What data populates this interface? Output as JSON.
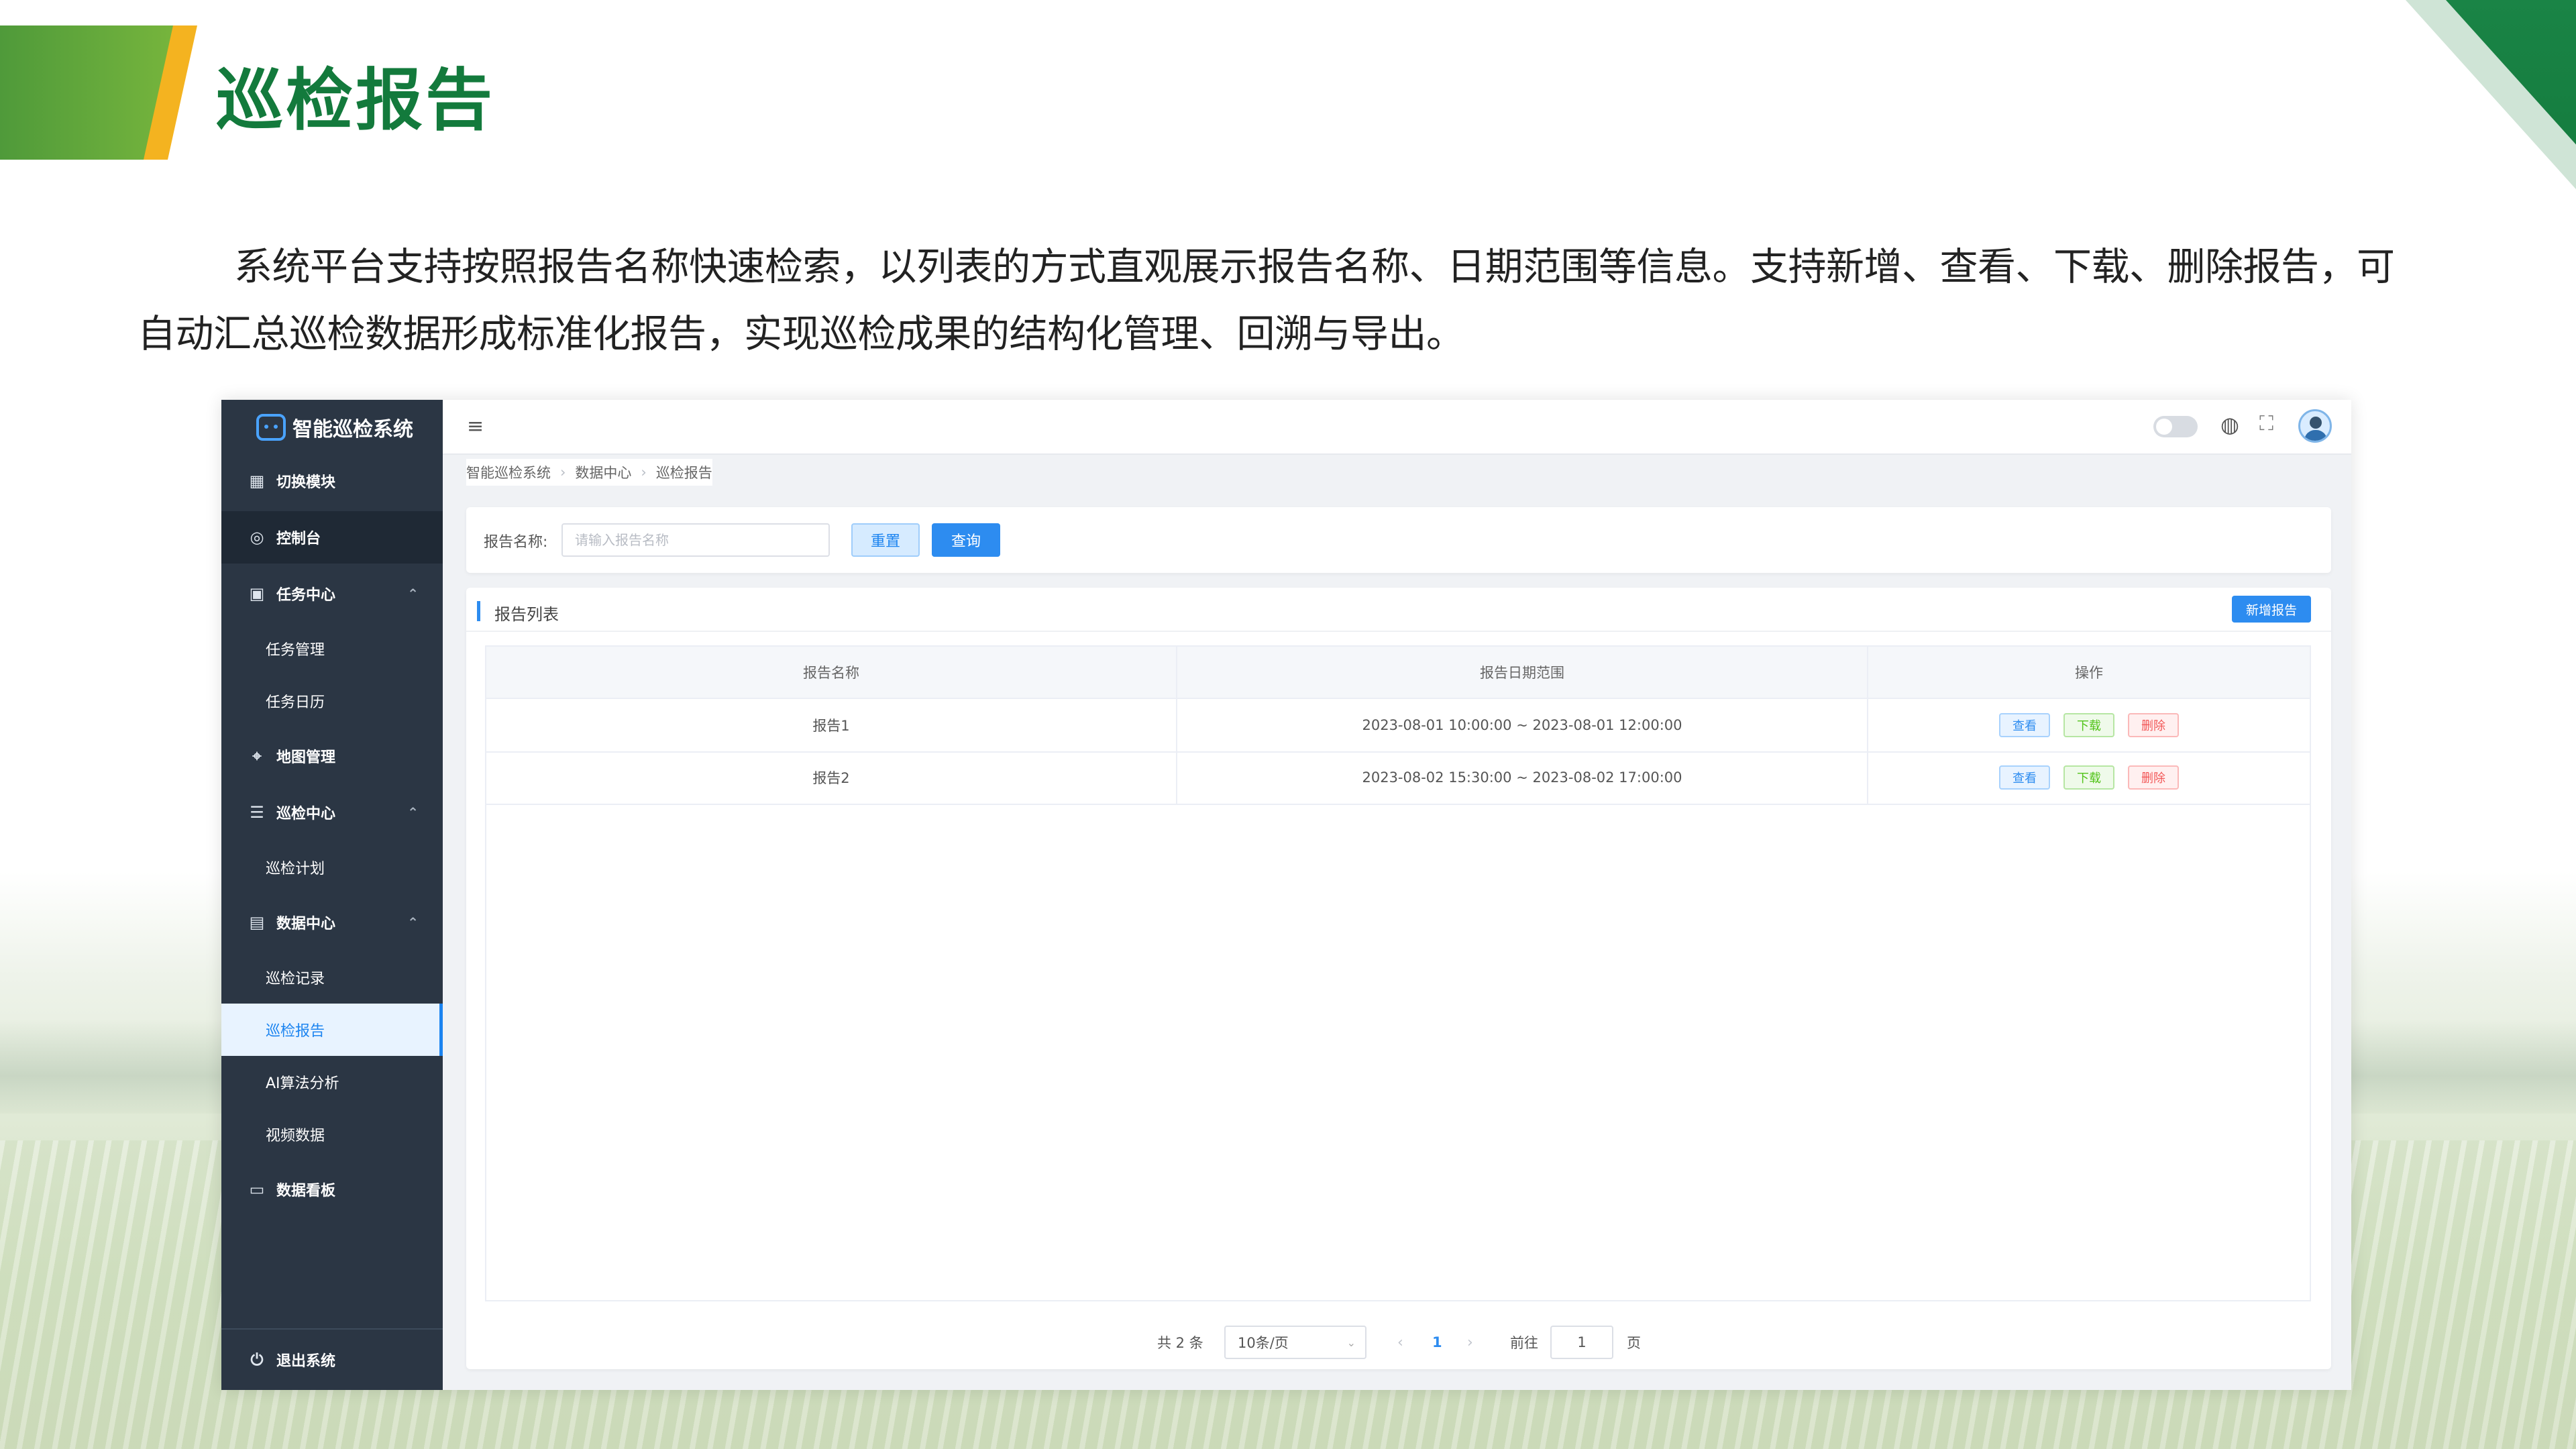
{
  "slide": {
    "title": "巡检报告",
    "intro": "系统平台支持按照报告名称快速检索，以列表的方式直观展示报告名称、日期范围等信息。支持新增、查看、下载、删除报告，可自动汇总巡检数据形成标准化报告，实现巡检成果的结构化管理、回溯与导出。"
  },
  "app": {
    "name": "智能巡检系统",
    "sidebar": {
      "items": [
        {
          "label": "切换模块",
          "icon": "grid-icon"
        },
        {
          "label": "控制台",
          "icon": "target-icon"
        },
        {
          "label": "任务中心",
          "icon": "calendar-icon",
          "expanded": true
        },
        {
          "label": "任务管理"
        },
        {
          "label": "任务日历"
        },
        {
          "label": "地图管理",
          "icon": "map-pin-icon"
        },
        {
          "label": "巡检中心",
          "icon": "clipboard-icon",
          "expanded": true
        },
        {
          "label": "巡检计划"
        },
        {
          "label": "数据中心",
          "icon": "chart-icon",
          "expanded": true
        },
        {
          "label": "巡检记录"
        },
        {
          "label": "巡检报告",
          "selected": true
        },
        {
          "label": "AI算法分析"
        },
        {
          "label": "视频数据"
        },
        {
          "label": "数据看板",
          "icon": "dashboard-icon"
        }
      ],
      "logout": "退出系统"
    },
    "breadcrumb": [
      "智能巡检系统",
      "数据中心",
      "巡检报告"
    ],
    "search": {
      "label": "报告名称:",
      "placeholder": "请输入报告名称",
      "value": "",
      "reset": "重置",
      "query": "查询"
    },
    "list": {
      "title": "报告列表",
      "add_button": "新增报告",
      "columns": [
        "报告名称",
        "报告日期范围",
        "操作"
      ],
      "rows": [
        {
          "name": "报告1",
          "range": "2023-08-01 10:00:00 ~ 2023-08-01 12:00:00"
        },
        {
          "name": "报告2",
          "range": "2023-08-02 15:30:00 ~ 2023-08-02 17:00:00"
        }
      ],
      "actions": {
        "view": "查看",
        "download": "下载",
        "delete": "删除"
      }
    },
    "pagination": {
      "total": "共 2 条",
      "page_size": "10条/页",
      "current": "1",
      "goto": "前往",
      "goto_value": "1",
      "page_suffix": "页"
    }
  },
  "colors": {
    "brand_green": "#137a3c",
    "accent_yellow": "#f4b320",
    "primary_blue": "#2d8cf0",
    "sidebar_bg": "#2b3644"
  }
}
